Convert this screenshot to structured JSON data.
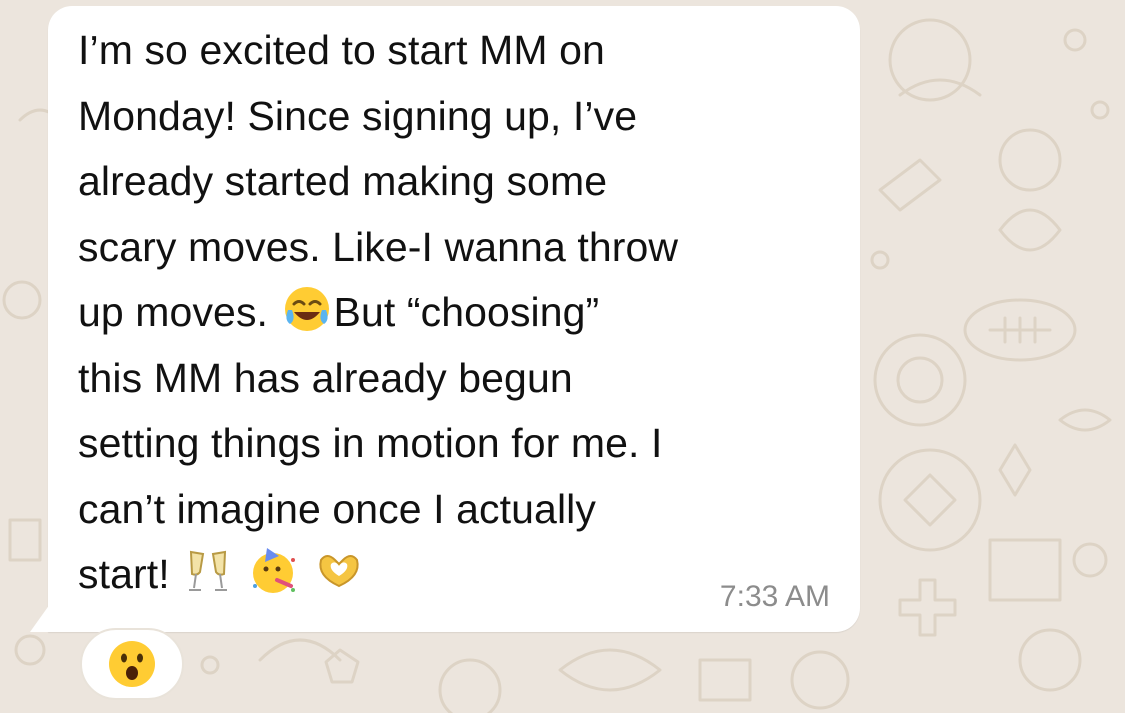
{
  "message": {
    "lines": [
      "I’m so excited to start MM on",
      "Monday! Since signing up, I’ve",
      "already started making some",
      "scary moves. Like-I wanna throw",
      "up moves.",
      "But “choosing”",
      "this MM has already begun",
      "setting things in motion for me. I",
      "can’t imagine once I actually",
      "start!"
    ],
    "timestamp": "7:33 AM",
    "inline_emojis": [
      "face-with-tears-of-joy-icon",
      "clinking-glasses-icon",
      "partying-face-icon",
      "heart-hands-icon"
    ]
  },
  "reaction": {
    "emoji": "face-with-open-mouth-icon"
  },
  "colors": {
    "wallpaper": "#ece5dd",
    "bubble": "#ffffff",
    "text": "#111111",
    "timestamp": "#8c8c8c",
    "emoji_yellow": "#ffcc33"
  }
}
